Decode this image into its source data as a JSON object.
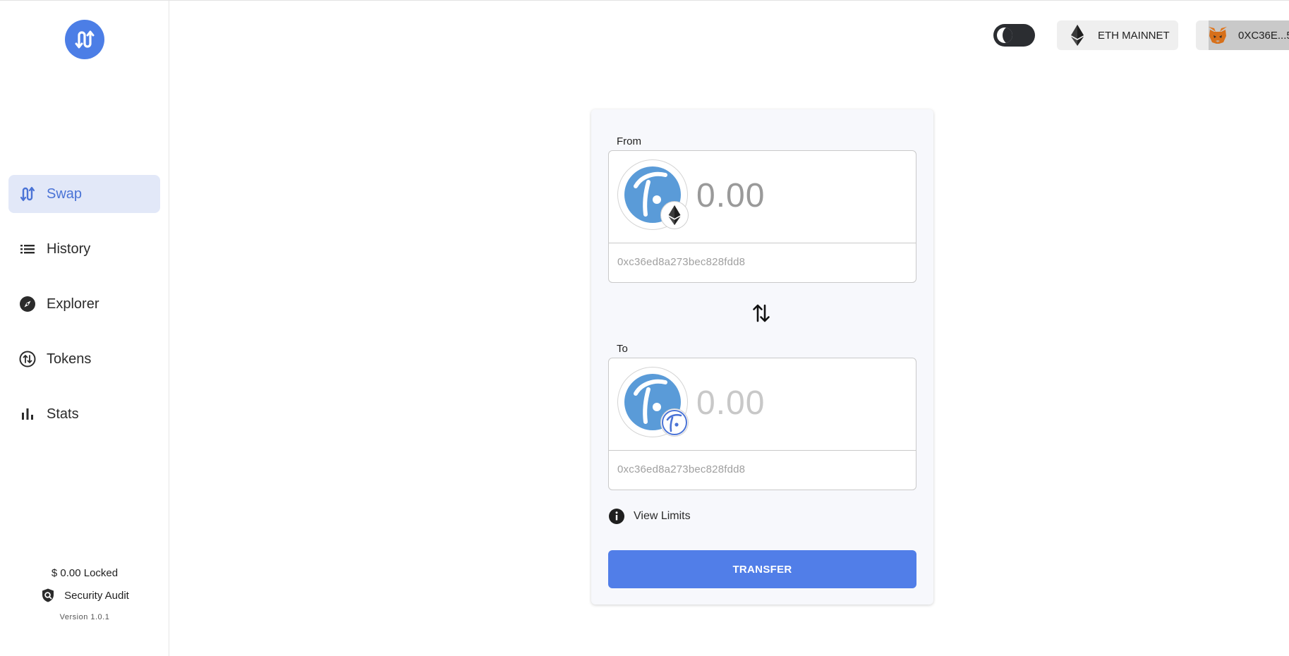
{
  "sidebar": {
    "logo_icon": "bridge-swap-logo-icon",
    "items": [
      {
        "label": "Swap",
        "icon": "swap-arrows-icon",
        "active": true
      },
      {
        "label": "History",
        "icon": "list-icon",
        "active": false
      },
      {
        "label": "Explorer",
        "icon": "compass-icon",
        "active": false
      },
      {
        "label": "Tokens",
        "icon": "token-exchange-icon",
        "active": false
      },
      {
        "label": "Stats",
        "icon": "bar-chart-icon",
        "active": false
      }
    ],
    "locked": "$ 0.00 Locked",
    "audit": "Security Audit",
    "version": "Version 1.0.1"
  },
  "topbar": {
    "network": "ETH MAINNET",
    "wallet": "0XC36E...5"
  },
  "swap": {
    "from_label": "From",
    "from_amount": "0.00",
    "from_address": "0xc36ed8a273bec828fdd8",
    "to_label": "To",
    "to_amount": "0.00",
    "to_address": "0xc36ed8a273bec828fdd8",
    "limits_label": "View Limits",
    "transfer_label": "TRANSFER"
  },
  "colors": {
    "accent": "#517ee8",
    "active_nav_bg": "#e2e8f8",
    "token_blue": "#5a9bd8"
  }
}
